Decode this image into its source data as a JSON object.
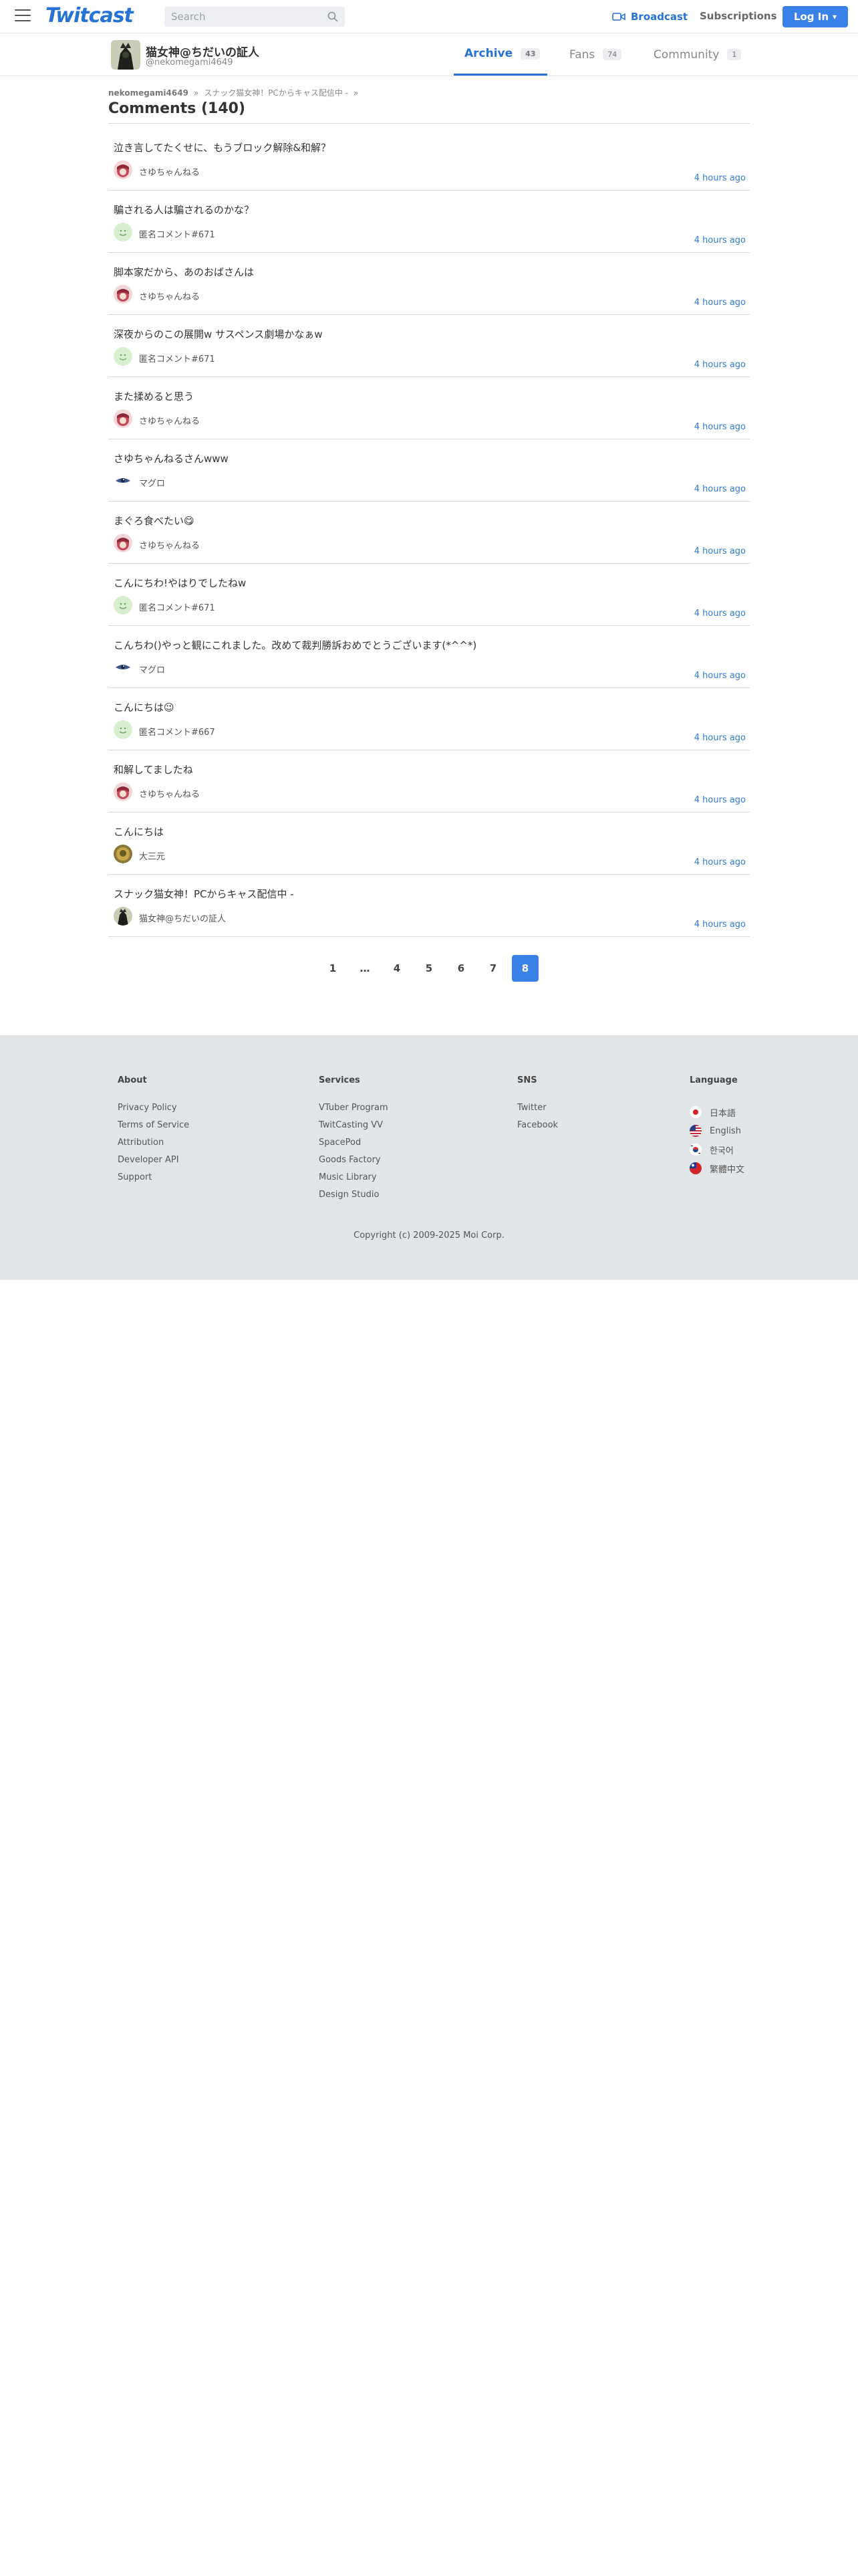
{
  "header": {
    "logo": "Twitcast",
    "search_placeholder": "Search",
    "broadcast_label": "Broadcast",
    "subscriptions_label": "Subscriptions",
    "login_label": "Log In",
    "brand_color": "#2673d4"
  },
  "profile": {
    "name": "猫女神@ちだいの証人",
    "id": "@nekomegami4649",
    "tabs": [
      {
        "label": "Archive",
        "count": "43",
        "active": true
      },
      {
        "label": "Fans",
        "count": "74",
        "active": false
      },
      {
        "label": "Community",
        "count": "1",
        "active": false
      }
    ]
  },
  "breadcrumb": {
    "user": "nekomegami4649",
    "separator": "»",
    "live": "スナック猫女神！PCからキャス配信中 -",
    "trailing": "»"
  },
  "page_title": "Comments (140)",
  "comments": [
    {
      "text": "泣き言してたくせに、もうブロック解除&和解？",
      "author": "さゆちゃんねる",
      "avatar": "sayu",
      "time": "4 hours ago"
    },
    {
      "text": "騙される人は騙されるのかな？",
      "author": "匿名コメント#671",
      "avatar": "anon",
      "time": "4 hours ago"
    },
    {
      "text": "脚本家だから、あのおばさんは",
      "author": "さゆちゃんねる",
      "avatar": "sayu",
      "time": "4 hours ago"
    },
    {
      "text": "深夜からのこの展開w サスペンス劇場かなぁw",
      "author": "匿名コメント#671",
      "avatar": "anon",
      "time": "4 hours ago"
    },
    {
      "text": "また揉めると思う",
      "author": "さゆちゃんねる",
      "avatar": "sayu",
      "time": "4 hours ago"
    },
    {
      "text": "さゆちゃんねるさんwww",
      "author": "マグロ",
      "avatar": "maguro",
      "time": "4 hours ago"
    },
    {
      "text": "まぐろ食べたい😋",
      "author": "さゆちゃんねる",
      "avatar": "sayu",
      "time": "4 hours ago"
    },
    {
      "text": "こんにちわ!やはりでしたねw",
      "author": "匿名コメント#671",
      "avatar": "anon",
      "time": "4 hours ago"
    },
    {
      "text": "こんちわ()やっと観にこれました。改めて裁判勝訴おめでとうございます(*^^*)",
      "author": "マグロ",
      "avatar": "maguro",
      "time": "4 hours ago"
    },
    {
      "text": "こんにちは😉",
      "author": "匿名コメント#667",
      "avatar": "anon",
      "time": "4 hours ago"
    },
    {
      "text": "和解してましたね",
      "author": "さゆちゃんねる",
      "avatar": "sayu",
      "time": "4 hours ago"
    },
    {
      "text": "こんにちは",
      "author": "大三元",
      "avatar": "daisangen",
      "time": "4 hours ago"
    },
    {
      "text": "スナック猫女神！PCからキャス配信中 -",
      "author": "猫女神@ちだいの証人",
      "avatar": "owner",
      "time": "4 hours ago"
    }
  ],
  "pagination": [
    {
      "label": "1",
      "active": false
    },
    {
      "label": "…",
      "active": false,
      "dots": true
    },
    {
      "label": "4",
      "active": false
    },
    {
      "label": "5",
      "active": false
    },
    {
      "label": "6",
      "active": false
    },
    {
      "label": "7",
      "active": false
    },
    {
      "label": "8",
      "active": true
    }
  ],
  "footer": {
    "columns": [
      {
        "title": "About",
        "links": [
          "Privacy Policy",
          "Terms of Service",
          "Attribution",
          "Developer API",
          "Support"
        ]
      },
      {
        "title": "Services",
        "links": [
          "VTuber Program",
          "TwitCasting VV",
          "SpacePod",
          "Goods Factory",
          "Music Library",
          "Design Studio"
        ]
      },
      {
        "title": "SNS",
        "links": [
          "Twitter",
          "Facebook"
        ]
      }
    ],
    "language": {
      "title": "Language",
      "items": [
        {
          "label": "日本語",
          "flag": "jp-flag-icon"
        },
        {
          "label": "English",
          "flag": "us-flag-icon"
        },
        {
          "label": "한국어",
          "flag": "kr-flag-icon"
        },
        {
          "label": "繁體中文",
          "flag": "tw-flag-icon"
        }
      ]
    },
    "copyright": "Copyright (c) 2009-2025 Moi Corp."
  }
}
